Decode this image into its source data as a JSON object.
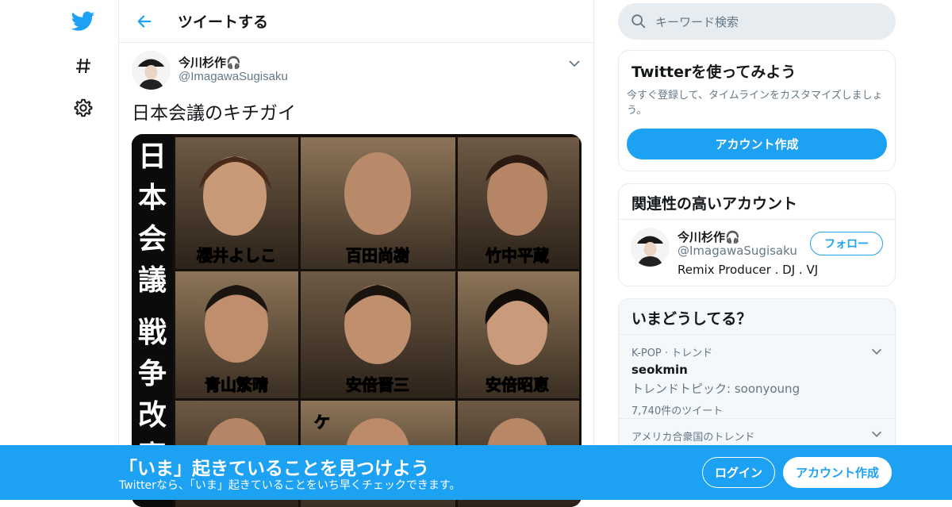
{
  "header": {
    "title": "ツイートする"
  },
  "nav": {
    "items": [
      "twitter-logo",
      "hashtag-icon",
      "settings-icon"
    ]
  },
  "tweet": {
    "display_name": "今川杉作🎧",
    "screen_name": "@ImagawaSugisaku",
    "text": "日本会議のキチガイ",
    "image_side_text": "日本会議 戦争改憲",
    "image_captions": [
      "櫻井よしこ",
      "百田尚樹",
      "竹中平蔵",
      "青山繁晴",
      "安倍晋三",
      "安倍昭恵",
      "ケ"
    ]
  },
  "search": {
    "placeholder": "キーワード検索"
  },
  "signup_card": {
    "title": "Twitterを使ってみよう",
    "description": "今すぐ登録して、タイムラインをカスタマイズしましょう。",
    "button": "アカウント作成"
  },
  "related_card": {
    "title": "関連性の高いアカウント",
    "display_name": "今川杉作🎧",
    "screen_name": "@ImagawaSugisaku",
    "bio": "Remix Producer . DJ . VJ",
    "follow_button": "フォロー"
  },
  "trends": {
    "title": "いまどうしてる？",
    "items": [
      {
        "label": "K-POP · トレンド",
        "name": "seokmin",
        "topic": "トレンドトピック: soonyoung",
        "count": "7,740件のツイート"
      },
      {
        "label": "アメリカ合衆国のトレンド"
      }
    ]
  },
  "bottom_bar": {
    "title": "「いま」起きていることを見つけよう",
    "subtitle": "Twitterなら、「いま」起きていることをいち早くチェックできます。",
    "login": "ログイン",
    "signup": "アカウント作成"
  },
  "colors": {
    "accent": "#1da1f2",
    "secondary_text": "#657786",
    "border": "#e6ecf0"
  }
}
